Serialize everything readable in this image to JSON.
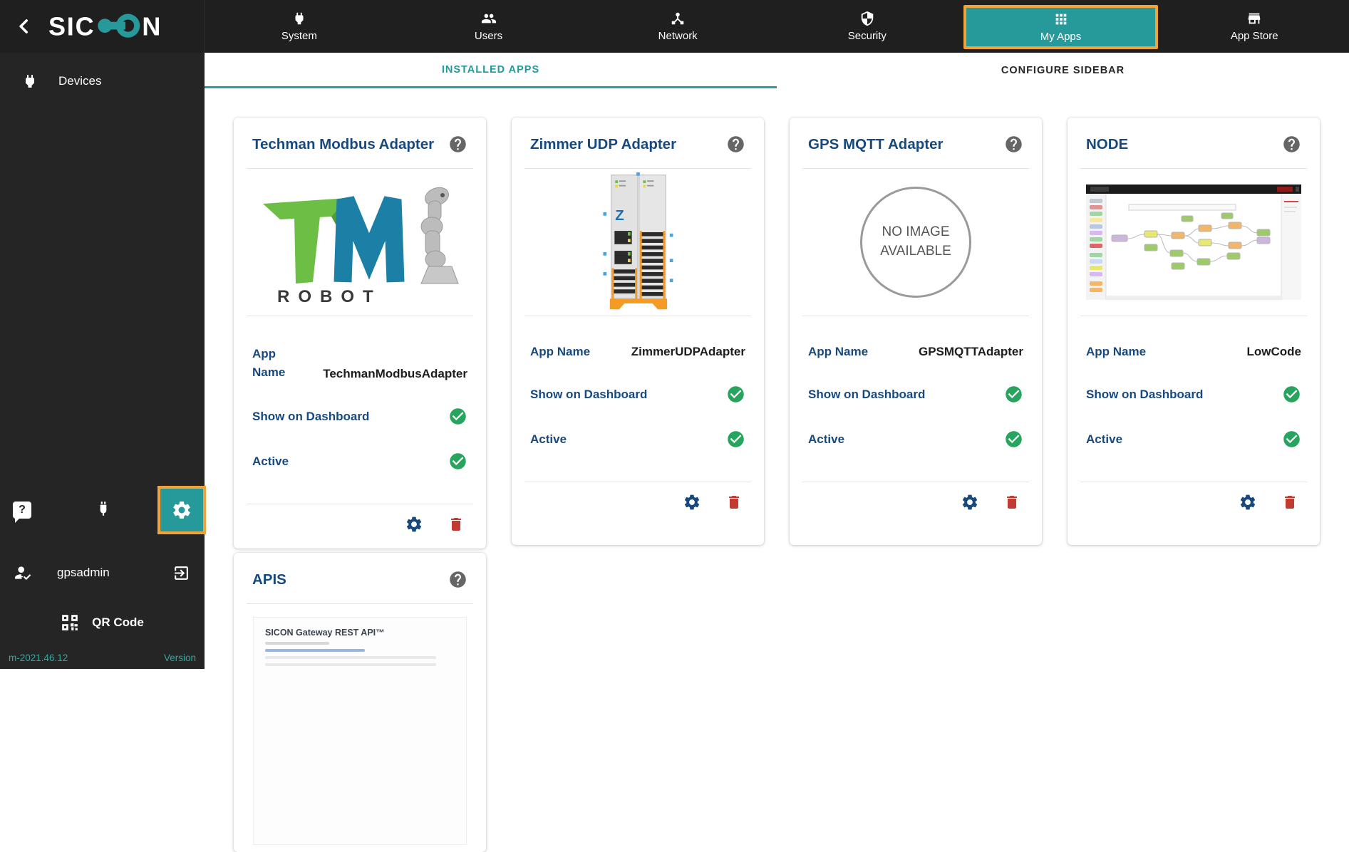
{
  "brand": {
    "logo_left": "SIC",
    "logo_right": "N"
  },
  "glyphs": {
    "question": "?"
  },
  "icons": {
    "back": "chevron-left",
    "system": "power-plug",
    "users": "people",
    "network": "device-hub",
    "security": "shield",
    "my_apps": "grid-3x3",
    "app_store": "storefront",
    "devices": "power-plug",
    "help_bubble": "question-bubble",
    "usb": "usb-plug",
    "settings": "gear",
    "user": "person-check",
    "logout": "exit-arrow",
    "qr": "qr-code",
    "card_help": "question-circle",
    "check": "check-circle",
    "delete": "trash"
  },
  "topnav": {
    "items": [
      {
        "label": "System",
        "active": false
      },
      {
        "label": "Users",
        "active": false
      },
      {
        "label": "Network",
        "active": false
      },
      {
        "label": "Security",
        "active": false
      },
      {
        "label": "My Apps",
        "active": true
      },
      {
        "label": "App Store",
        "active": false
      }
    ]
  },
  "tabs": [
    {
      "label": "INSTALLED APPS",
      "active": true
    },
    {
      "label": "CONFIGURE SIDEBAR",
      "active": false
    }
  ],
  "sidebar": {
    "devices_label": "Devices",
    "username": "gpsadmin",
    "qr_label": "QR Code",
    "version_value": "m-2021.46.12",
    "version_label": "Version"
  },
  "card_labels": {
    "app_name": "App Name",
    "show_on_dashboard": "Show on Dashboard",
    "active": "Active"
  },
  "cards": [
    {
      "title": "Techman Modbus Adapter",
      "app_name": "TechmanModbusAdapter",
      "show_on_dashboard": true,
      "active": true,
      "image": "tm-robot-logo-and-arm",
      "logo_caption": "ROBOT"
    },
    {
      "title": "Zimmer UDP Adapter",
      "app_name": "ZimmerUDPAdapter",
      "show_on_dashboard": true,
      "active": true,
      "image": "zimmer-io-module",
      "logo_glyph": "Z"
    },
    {
      "title": "GPS MQTT Adapter",
      "app_name": "GPSMQTTAdapter",
      "show_on_dashboard": true,
      "active": true,
      "image": "none",
      "no_image_text": "NO IMAGE AVAILABLE"
    },
    {
      "title": "NODE",
      "app_name": "LowCode",
      "show_on_dashboard": true,
      "active": true,
      "image": "node-red-flow-screenshot"
    }
  ],
  "apis_card": {
    "title": "APIS",
    "doc_heading": "SICON Gateway REST API™"
  },
  "colors": {
    "accent_teal": "#26999B",
    "highlight_orange": "#F2A237",
    "title_blue": "#17497E",
    "check_green": "#27A45E",
    "delete_red": "#C13B33",
    "topbar": "#1F1F1F",
    "sidebar": "#252525"
  }
}
